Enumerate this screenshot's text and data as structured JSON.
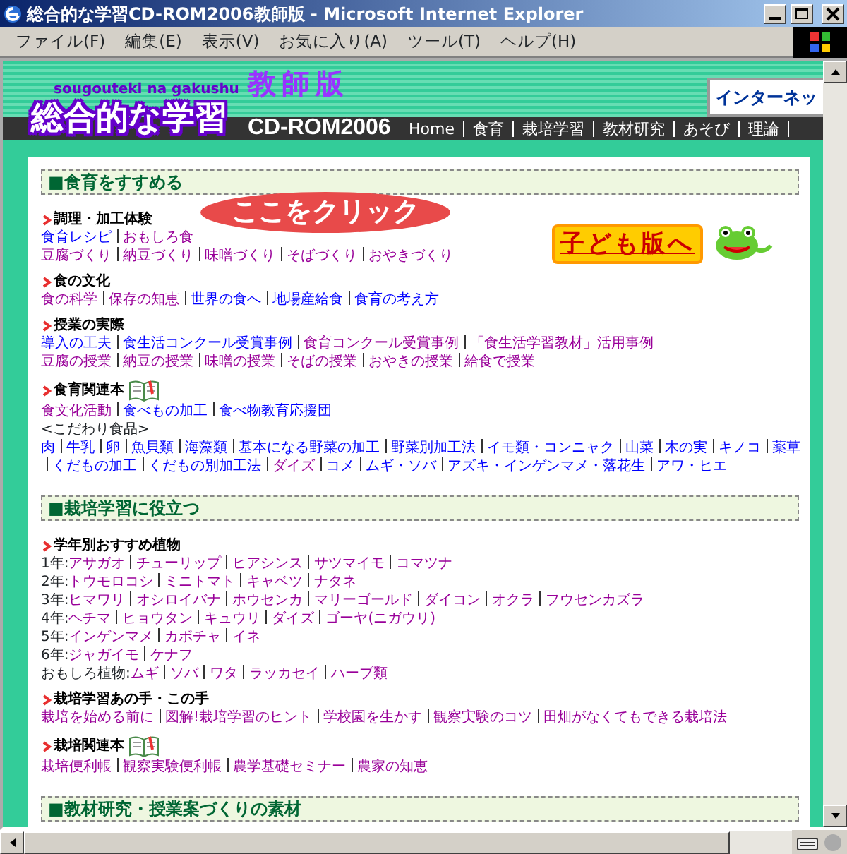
{
  "window": {
    "title": "総合的な学習CD-ROM2006教師版 - Microsoft Internet Explorer"
  },
  "menu": [
    "ファイル(F)",
    "編集(E)",
    "表示(V)",
    "お気に入り(A)",
    "ツール(T)",
    "ヘルプ(H)"
  ],
  "header": {
    "romaji": "sougouteki na gakushu",
    "title": "総合的な学習",
    "edition": "教師版",
    "product": "CD-ROM2006",
    "internet_button": "インターネッ",
    "nav": [
      "Home",
      "食育",
      "栽培学習",
      "教材研究",
      "あそび",
      "理論"
    ]
  },
  "callout": "ここをクリック",
  "kids_button": "子ども版へ",
  "sections": [
    {
      "title": "■食育をすすめる",
      "groups": [
        {
          "heading": "調理・加工体験",
          "book": false,
          "lines": [
            {
              "kind": "links",
              "links": [
                {
                  "text": "食育レシピ",
                  "visited": false
                },
                {
                  "text": "おもしろ食",
                  "visited": true
                }
              ]
            },
            {
              "kind": "links",
              "links": [
                {
                  "text": "豆腐づくり",
                  "visited": true
                },
                {
                  "text": "納豆づくり",
                  "visited": true
                },
                {
                  "text": "味噌づくり",
                  "visited": true
                },
                {
                  "text": "そばづくり",
                  "visited": true
                },
                {
                  "text": "おやきづくり",
                  "visited": true
                }
              ]
            }
          ]
        },
        {
          "heading": "食の文化",
          "book": false,
          "lines": [
            {
              "kind": "links",
              "links": [
                {
                  "text": "食の科学",
                  "visited": true
                },
                {
                  "text": "保存の知恵",
                  "visited": true
                },
                {
                  "text": "世界の食へ",
                  "visited": false
                },
                {
                  "text": "地場産給食",
                  "visited": false
                },
                {
                  "text": "食育の考え方",
                  "visited": false
                }
              ]
            }
          ]
        },
        {
          "heading": "授業の実際",
          "book": false,
          "lines": [
            {
              "kind": "links",
              "links": [
                {
                  "text": "導入の工夫",
                  "visited": false
                },
                {
                  "text": "食生活コンクール受賞事例",
                  "visited": false
                },
                {
                  "text": "食育コンクール受賞事例",
                  "visited": true
                },
                {
                  "text": "「食生活学習教材」活用事例",
                  "visited": true
                }
              ]
            },
            {
              "kind": "links",
              "links": [
                {
                  "text": "豆腐の授業",
                  "visited": true
                },
                {
                  "text": "納豆の授業",
                  "visited": true
                },
                {
                  "text": "味噌の授業",
                  "visited": true
                },
                {
                  "text": "そばの授業",
                  "visited": true
                },
                {
                  "text": "おやきの授業",
                  "visited": true
                },
                {
                  "text": "給食で授業",
                  "visited": true
                }
              ]
            }
          ]
        },
        {
          "heading": "食育関連本",
          "book": true,
          "lines": [
            {
              "kind": "links",
              "links": [
                {
                  "text": "食文化活動",
                  "visited": true
                },
                {
                  "text": "食べもの加工",
                  "visited": false
                },
                {
                  "text": "食べ物教育応援団",
                  "visited": false
                }
              ]
            },
            {
              "kind": "label",
              "text": "<こだわり食品>"
            },
            {
              "kind": "links",
              "links": [
                {
                  "text": "肉",
                  "visited": false
                },
                {
                  "text": "牛乳",
                  "visited": false
                },
                {
                  "text": "卵",
                  "visited": false
                },
                {
                  "text": "魚貝類",
                  "visited": false
                },
                {
                  "text": "海藻類",
                  "visited": false
                },
                {
                  "text": "基本になる野菜の加工",
                  "visited": false
                },
                {
                  "text": "野菜別加工法",
                  "visited": false
                },
                {
                  "text": "イモ類・コンニャク",
                  "visited": false
                },
                {
                  "text": "山菜",
                  "visited": false
                },
                {
                  "text": "木の実",
                  "visited": false
                },
                {
                  "text": "キノコ",
                  "visited": false
                },
                {
                  "text": "薬草",
                  "visited": false
                }
              ]
            },
            {
              "kind": "links",
              "leading_rule": true,
              "links": [
                {
                  "text": "くだもの加工",
                  "visited": false
                },
                {
                  "text": "くだもの別加工法",
                  "visited": false
                },
                {
                  "text": "ダイズ",
                  "visited": true
                },
                {
                  "text": "コメ",
                  "visited": false
                },
                {
                  "text": "ムギ・ソバ",
                  "visited": false
                },
                {
                  "text": "アズキ・インゲンマメ・落花生",
                  "visited": false
                },
                {
                  "text": "アワ・ヒエ",
                  "visited": false
                }
              ]
            }
          ]
        }
      ]
    },
    {
      "title": "■栽培学習に役立つ",
      "groups": [
        {
          "heading": "学年別おすすめ植物",
          "book": false,
          "lines": [
            {
              "kind": "links",
              "prefix": "1年:",
              "links": [
                {
                  "text": "アサガオ",
                  "visited": true
                },
                {
                  "text": "チューリップ",
                  "visited": true
                },
                {
                  "text": "ヒアシンス",
                  "visited": true
                },
                {
                  "text": "サツマイモ",
                  "visited": true
                },
                {
                  "text": "コマツナ",
                  "visited": true
                }
              ]
            },
            {
              "kind": "links",
              "prefix": "2年:",
              "links": [
                {
                  "text": "トウモロコシ",
                  "visited": true
                },
                {
                  "text": "ミニトマト",
                  "visited": true
                },
                {
                  "text": "キャベツ",
                  "visited": true
                },
                {
                  "text": "ナタネ",
                  "visited": true
                }
              ]
            },
            {
              "kind": "links",
              "prefix": "3年:",
              "links": [
                {
                  "text": "ヒマワリ",
                  "visited": true
                },
                {
                  "text": "オシロイバナ",
                  "visited": true
                },
                {
                  "text": "ホウセンカ",
                  "visited": true
                },
                {
                  "text": "マリーゴールド",
                  "visited": true
                },
                {
                  "text": "ダイコン",
                  "visited": true
                },
                {
                  "text": "オクラ",
                  "visited": true
                },
                {
                  "text": "フウセンカズラ",
                  "visited": true
                }
              ]
            },
            {
              "kind": "links",
              "prefix": "4年:",
              "links": [
                {
                  "text": "ヘチマ",
                  "visited": true
                },
                {
                  "text": "ヒョウタン",
                  "visited": true
                },
                {
                  "text": "キュウリ",
                  "visited": true
                },
                {
                  "text": "ダイズ",
                  "visited": true
                },
                {
                  "text": "ゴーヤ(ニガウリ)",
                  "visited": true
                }
              ]
            },
            {
              "kind": "links",
              "prefix": "5年:",
              "links": [
                {
                  "text": "インゲンマメ",
                  "visited": true
                },
                {
                  "text": "カボチャ",
                  "visited": true
                },
                {
                  "text": "イネ",
                  "visited": true
                }
              ]
            },
            {
              "kind": "links",
              "prefix": "6年:",
              "links": [
                {
                  "text": "ジャガイモ",
                  "visited": true
                },
                {
                  "text": "ケナフ",
                  "visited": true
                }
              ]
            },
            {
              "kind": "links",
              "prefix": "おもしろ植物:",
              "links": [
                {
                  "text": "ムギ",
                  "visited": true
                },
                {
                  "text": "ソバ",
                  "visited": true
                },
                {
                  "text": "ワタ",
                  "visited": true
                },
                {
                  "text": "ラッカセイ",
                  "visited": true
                },
                {
                  "text": "ハーブ類",
                  "visited": true
                }
              ]
            }
          ]
        },
        {
          "heading": "栽培学習あの手・この手",
          "book": false,
          "lines": [
            {
              "kind": "links",
              "links": [
                {
                  "text": "栽培を始める前に",
                  "visited": true
                },
                {
                  "text": "図解!栽培学習のヒント",
                  "visited": true
                },
                {
                  "text": "学校園を生かす",
                  "visited": true
                },
                {
                  "text": "観察実験のコツ",
                  "visited": true
                },
                {
                  "text": "田畑がなくてもできる栽培法",
                  "visited": true
                }
              ]
            }
          ]
        },
        {
          "heading": "栽培関連本",
          "book": true,
          "lines": [
            {
              "kind": "links",
              "links": [
                {
                  "text": "栽培便利帳",
                  "visited": true
                },
                {
                  "text": "観察実験便利帳",
                  "visited": true
                },
                {
                  "text": "農学基礎セミナー",
                  "visited": true
                },
                {
                  "text": "農家の知恵",
                  "visited": true
                }
              ]
            }
          ]
        }
      ]
    },
    {
      "title": "■教材研究・授業案づくりの素材"
    }
  ]
}
